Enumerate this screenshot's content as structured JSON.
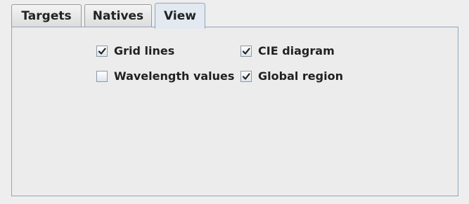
{
  "tabs": [
    {
      "label": "Targets",
      "selected": false
    },
    {
      "label": "Natives",
      "selected": false
    },
    {
      "label": "View",
      "selected": true
    }
  ],
  "view_panel": {
    "checkboxes": [
      {
        "label": "Grid lines",
        "checked": true
      },
      {
        "label": "Wavelength values",
        "checked": false
      },
      {
        "label": "CIE diagram",
        "checked": true
      },
      {
        "label": "Global region",
        "checked": true
      }
    ]
  },
  "colors": {
    "window_bg": "#eeeeee",
    "selected_tab_bg": "#e3e9f1",
    "panel_border": "#8fa6c2",
    "text": "#222222"
  }
}
